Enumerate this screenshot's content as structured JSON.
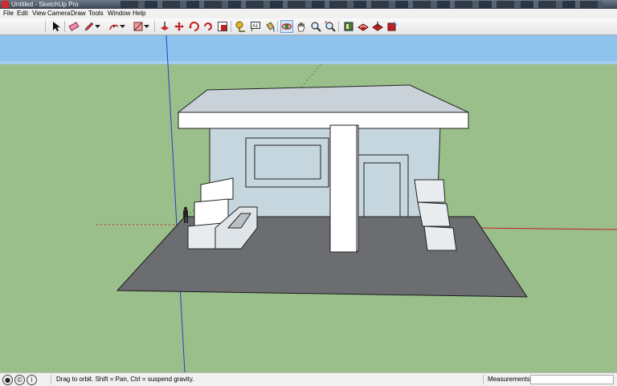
{
  "window": {
    "title": "Untitled - SketchUp Pro"
  },
  "menu": [
    "File",
    "Edit",
    "View",
    "Camera",
    "Draw",
    "Tools",
    "Window",
    "Help"
  ],
  "toolbar": {
    "tools": [
      "select-icon",
      "eraser-icon",
      "pencil-icon",
      "arc-icon",
      "rectangle-icon",
      "push-pull-icon",
      "move-icon",
      "rotate-icon",
      "offset-icon",
      "scale-icon",
      "tape-measure-icon",
      "text-icon",
      "paint-bucket-icon",
      "orbit-icon",
      "pan-icon",
      "zoom-icon",
      "zoom-extents-icon",
      "components-icon",
      "materials-icon",
      "get-models-icon",
      "share-model-icon"
    ],
    "active_tool": "orbit-icon",
    "text_tool_glyph": "A1"
  },
  "colors": {
    "sky": "#8ec3ee",
    "ground": "#9abf8b",
    "slab": "#6b6d71",
    "wall": "#c6d6de",
    "white": "#ffffff"
  },
  "status": {
    "icons": [
      "geo-location-icon",
      "credits-icon",
      "help-icon"
    ],
    "message": "Drag to orbit. Shift = Pan, Ctrl = suspend gravity.",
    "measurements_label": "Measurements",
    "measurements_value": ""
  }
}
